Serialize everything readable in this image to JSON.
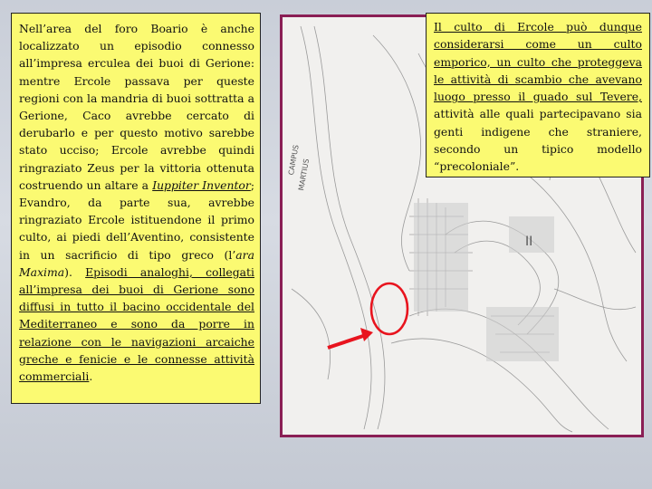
{
  "left_text": {
    "p1": "Nell’area del foro Boario è anche localizzato un episodio connesso all’impresa erculea dei buoi di Gerione: mentre Ercole passava per queste regioni con la mandria di buoi sottratta a Gerione, Caco avrebbe cercato di derubarlo e per questo motivo sarebbe stato ucciso; Ercole avrebbe quindi ringraziato Zeus per la vittoria ottenuta costruendo un altare a ",
    "p1_italic": "Iuppiter Inventor",
    "p2": "; Evandro, da parte sua, avrebbe ringraziato Ercole istituendone il primo culto, ai piedi dell’Aventino, consistente in un sacrificio di tipo greco (l’",
    "p2_italic": "ara Maxima",
    "p3": "). ",
    "p4_underlined": "Episodi analoghi, collegati all’impresa dei buoi di Gerione sono diffusi in tutto il bacino occidentale del Mediterraneo e sono da porre in relazione con le navigazioni arcaiche greche e fenicie e le connesse attività commerciali",
    "p5": "."
  },
  "right_text": {
    "underlined": "Il culto di Ercole può dunque considerarsi come un culto emporico, un culto che proteggeva le attività di scambio che avevano luogo presso il guado sul Tevere,",
    "rest": " attività alle quali partecipavano sia genti indigene che straniere, secondo un tipico modello “precoloniale”."
  },
  "map": {
    "labels": [
      "CAMPUS",
      "MARTIUS",
      "II"
    ]
  },
  "colors": {
    "text_box_bg": "#fbfa72",
    "map_border": "#8a1f55",
    "marker_red": "#e8141e"
  }
}
